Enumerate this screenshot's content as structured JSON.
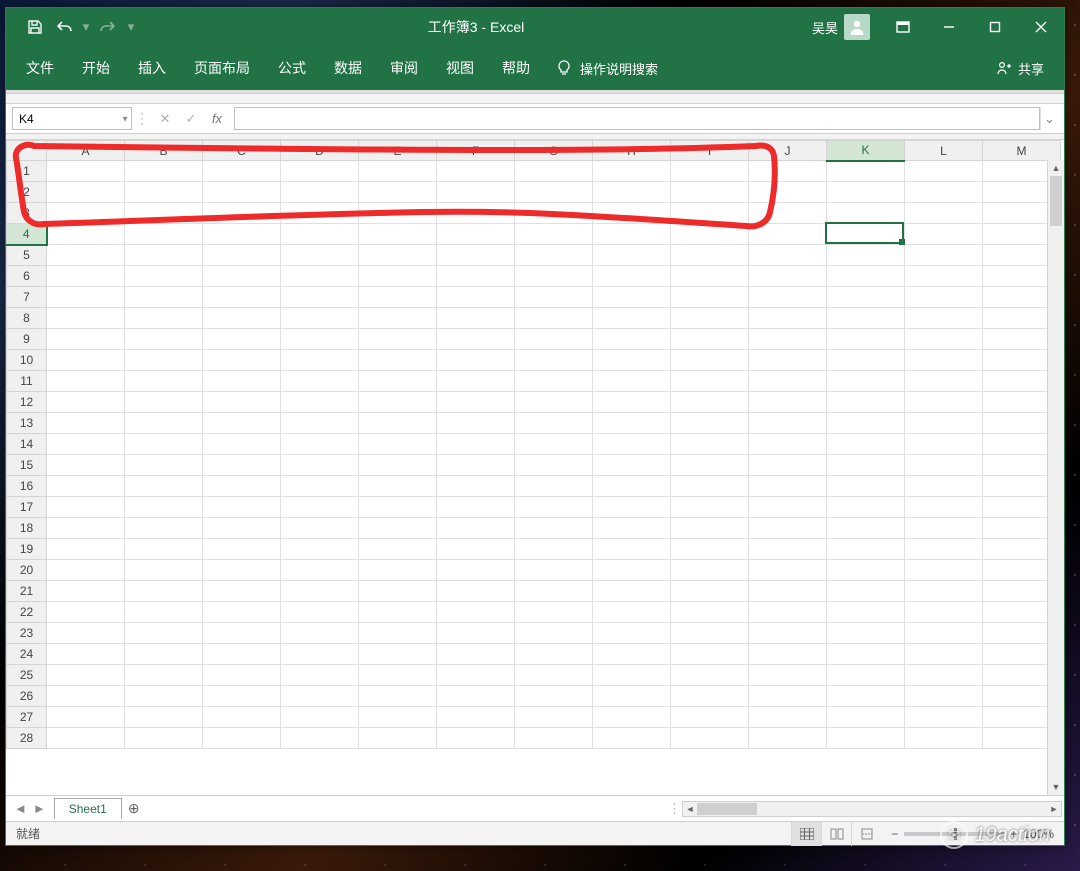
{
  "window": {
    "title": "工作簿3 - Excel",
    "user": "吴昊"
  },
  "menu": {
    "file": "文件",
    "home": "开始",
    "insert": "插入",
    "layout": "页面布局",
    "formula": "公式",
    "data": "数据",
    "review": "审阅",
    "view": "视图",
    "help": "帮助",
    "tellme": "操作说明搜索",
    "share": "共享"
  },
  "namebox": {
    "value": "K4"
  },
  "formula": {
    "value": ""
  },
  "columns": [
    "A",
    "B",
    "C",
    "D",
    "E",
    "F",
    "G",
    "H",
    "I",
    "J",
    "K",
    "L",
    "M"
  ],
  "rows": [
    1,
    2,
    3,
    4,
    5,
    6,
    7,
    8,
    9,
    10,
    11,
    12,
    13,
    14,
    15,
    16,
    17,
    18,
    19,
    20,
    21,
    22,
    23,
    24,
    25,
    26,
    27,
    28
  ],
  "active_cell": {
    "col": "K",
    "row": 4,
    "colIndex": 10,
    "rowIndex": 3
  },
  "sheets": {
    "active": "Sheet1"
  },
  "status": {
    "ready": "就绪",
    "zoom": "100%"
  },
  "watermark": "19action",
  "icons": {
    "save": "save",
    "undo": "undo",
    "redo": "redo",
    "dropdown": "▾"
  }
}
